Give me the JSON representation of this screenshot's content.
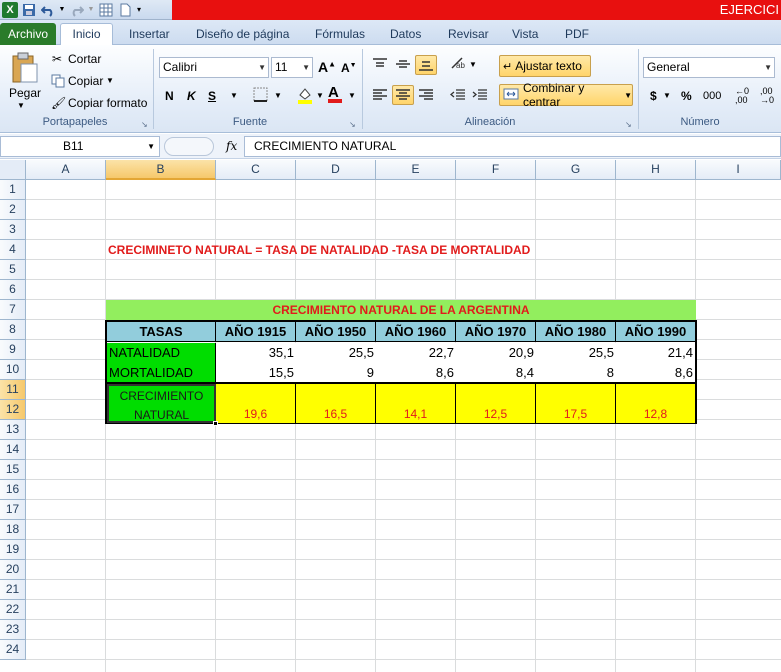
{
  "window": {
    "title": "EJERCICI",
    "qat_icons": [
      "excel-logo",
      "save-icon",
      "undo-icon",
      "redo-icon",
      "table-icon",
      "new-doc-icon",
      "customize-icon"
    ]
  },
  "tabs": [
    "Archivo",
    "Inicio",
    "Insertar",
    "Diseño de página",
    "Fórmulas",
    "Datos",
    "Revisar",
    "Vista",
    "PDF"
  ],
  "ribbon": {
    "clipboard": {
      "paste": "Pegar",
      "cut": "Cortar",
      "copy": "Copiar",
      "format_painter": "Copiar formato",
      "label": "Portapapeles"
    },
    "font": {
      "name": "Calibri",
      "size": "11",
      "bold": "N",
      "italic": "K",
      "underline": "S",
      "label": "Fuente"
    },
    "alignment": {
      "wrap": "Ajustar texto",
      "merge": "Combinar y centrar",
      "label": "Alineación"
    },
    "number": {
      "format": "General",
      "currency": "$",
      "percent": "%",
      "thousands": "000",
      "label": "Número"
    }
  },
  "formula_bar": {
    "name_box": "B11",
    "fx": "fx",
    "content": "CRECIMIENTO NATURAL"
  },
  "columns": [
    "A",
    "B",
    "C",
    "D",
    "E",
    "F",
    "G",
    "H",
    "I"
  ],
  "rows": [
    "1",
    "2",
    "3",
    "4",
    "5",
    "6",
    "7",
    "8",
    "9",
    "10",
    "11",
    "12",
    "13",
    "14",
    "15",
    "16",
    "17",
    "18",
    "19",
    "20",
    "21",
    "22",
    "23",
    "24"
  ],
  "sheet": {
    "formula_note": "CRECIMINETO NATURAL = TASA DE NATALIDAD -TASA DE MORTALIDAD",
    "table_title": "CRECIMIENTO NATURAL DE LA ARGENTINA",
    "headers": [
      "TASAS",
      "AÑO 1915",
      "AÑO 1950",
      "AÑO 1960",
      "AÑO 1970",
      "AÑO 1980",
      "AÑO 1990"
    ],
    "natalidad": {
      "label": "NATALIDAD",
      "values": [
        "35,1",
        "25,5",
        "22,7",
        "20,9",
        "25,5",
        "21,4"
      ]
    },
    "mortalidad": {
      "label": "MORTALIDAD",
      "values": [
        "15,5",
        "9",
        "8,6",
        "8,4",
        "8",
        "8,6"
      ]
    },
    "crecimiento": {
      "label_line1": "CRECIMIENTO",
      "label_line2": "NATURAL",
      "values": [
        "19,6",
        "16,5",
        "14,1",
        "12,5",
        "17,5",
        "12,8"
      ]
    }
  },
  "colors": {
    "green_fill": "#00dd00",
    "light_green": "#92ee5e",
    "header_blue": "#92cddc",
    "yellow": "#ffff00",
    "red_text": "#e11b1b"
  }
}
